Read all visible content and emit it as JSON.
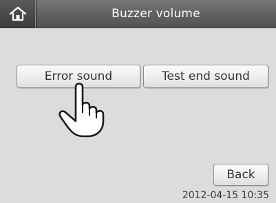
{
  "header": {
    "home_icon": "home-icon",
    "title": "Buzzer volume"
  },
  "buttons": {
    "error_sound": "Error sound",
    "test_end_sound": "Test end sound",
    "back": "Back"
  },
  "overlay": {
    "pointer_icon": "hand-pointer-icon"
  },
  "status": {
    "datetime": "2012-04-15 10:35"
  },
  "colors": {
    "header_bg": "#606060",
    "screen_bg": "#dcdcdc",
    "button_bg": "#ececec"
  }
}
